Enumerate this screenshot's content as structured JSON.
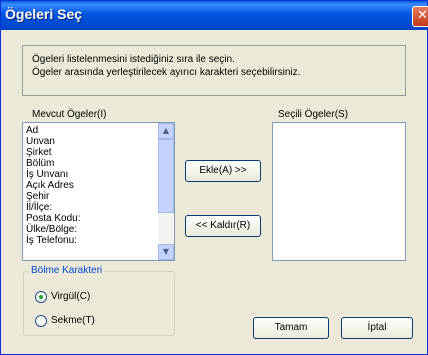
{
  "window": {
    "title": "Ögeleri Seç",
    "close_glyph": "✕"
  },
  "info": {
    "line1": "Ögeleri listelenmesini istediğiniz sıra ile seçin.",
    "line2": "Ögeler arasında yerleştirilecek ayırıcı karakteri seçebilirsiniz."
  },
  "available": {
    "label": "Mevcut Ögeler(I)",
    "items": [
      "Ad",
      "Unvan",
      "Şirket",
      "Bölüm",
      "İş Unvanı",
      "Açık Adres",
      "Şehir",
      "İl/İlçe:",
      "Posta Kodu:",
      "Ülke/Bölge:",
      "İş Telefonu:"
    ]
  },
  "selected": {
    "label": "Seçili Ögeler(S)",
    "items": []
  },
  "buttons": {
    "add": "Ekle(A) >>",
    "remove": "<< Kaldır(R)",
    "ok": "Tamam",
    "cancel": "İptal"
  },
  "separator": {
    "title": "Bölme Karakteri",
    "options": [
      {
        "label": "Virgül(C)",
        "checked": true
      },
      {
        "label": "Sekme(T)",
        "checked": false
      }
    ]
  },
  "icons": {
    "close": "close-icon",
    "scroll_up": "scroll-up-arrow-icon",
    "scroll_down": "scroll-down-arrow-icon"
  },
  "colors": {
    "titlebar": "#0054e3",
    "dialog_bg": "#ece9d8",
    "group_title": "#0046d5",
    "radio_check": "#21a121"
  }
}
